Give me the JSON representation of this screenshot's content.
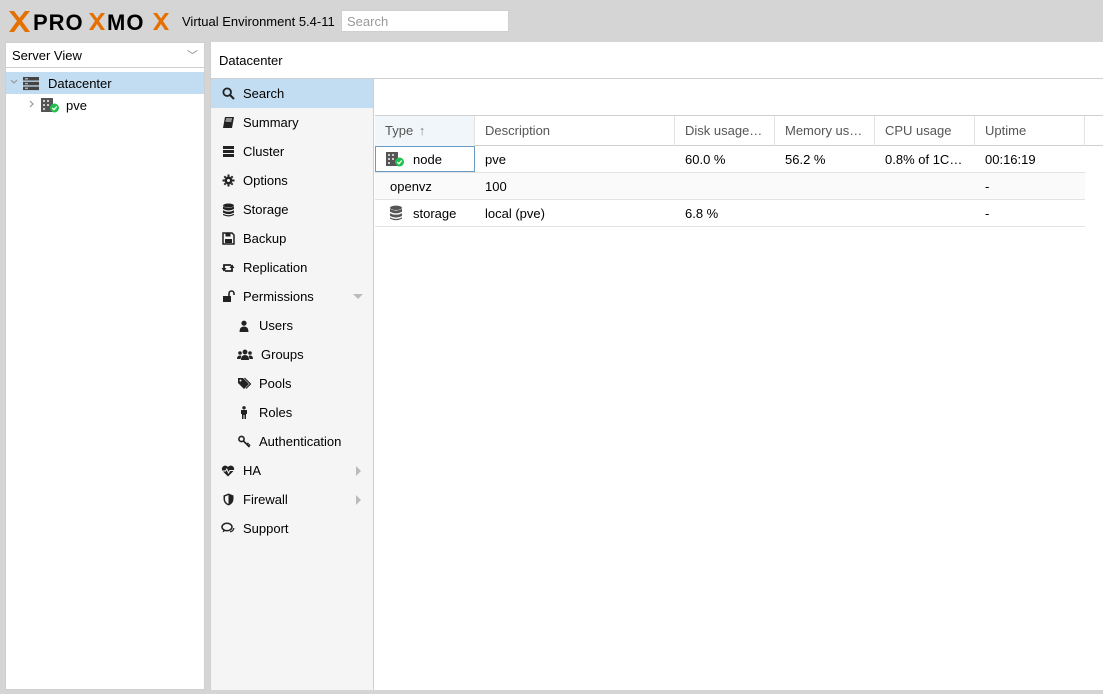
{
  "header": {
    "brand": "PROXMOX",
    "version": "Virtual Environment 5.4-11",
    "search_placeholder": "Search"
  },
  "tree": {
    "view": "Server View",
    "items": [
      {
        "label": "Datacenter"
      },
      {
        "label": "pve"
      }
    ]
  },
  "content": {
    "title": "Datacenter"
  },
  "menu": {
    "items": [
      {
        "label": "Search"
      },
      {
        "label": "Summary"
      },
      {
        "label": "Cluster"
      },
      {
        "label": "Options"
      },
      {
        "label": "Storage"
      },
      {
        "label": "Backup"
      },
      {
        "label": "Replication"
      },
      {
        "label": "Permissions"
      },
      {
        "label": "Users"
      },
      {
        "label": "Groups"
      },
      {
        "label": "Pools"
      },
      {
        "label": "Roles"
      },
      {
        "label": "Authentication"
      },
      {
        "label": "HA"
      },
      {
        "label": "Firewall"
      },
      {
        "label": "Support"
      }
    ]
  },
  "grid": {
    "columns": [
      "Type",
      "Description",
      "Disk usage…",
      "Memory us…",
      "CPU usage",
      "Uptime"
    ],
    "sort_arrow": "↑",
    "rows": [
      {
        "type": "node",
        "desc": "pve",
        "disk": "60.0 %",
        "mem": "56.2 %",
        "cpu": "0.8% of 1C…",
        "uptime": "00:16:19"
      },
      {
        "type": "openvz",
        "desc": "100",
        "disk": "",
        "mem": "",
        "cpu": "",
        "uptime": "-"
      },
      {
        "type": "storage",
        "desc": "local (pve)",
        "disk": "6.8 %",
        "mem": "",
        "cpu": "",
        "uptime": "-"
      }
    ]
  },
  "colors": {
    "brand_orange": "#e57000",
    "selection": "#c2ddf2",
    "status_ok": "#21bf4b"
  }
}
